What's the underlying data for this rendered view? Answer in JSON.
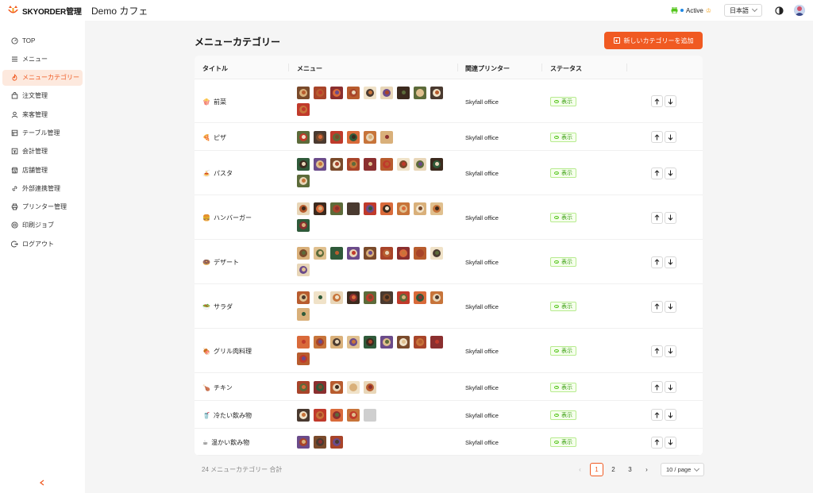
{
  "brand": {
    "name": "SKYORDER管理"
  },
  "header": {
    "store_name": "Demo カフェ",
    "printer_status": "Active",
    "language": "日本語"
  },
  "sidebar": {
    "items": [
      {
        "label": "TOP",
        "icon": "dashboard-icon",
        "active": false
      },
      {
        "label": "メニュー",
        "icon": "list-icon",
        "active": false
      },
      {
        "label": "メニューカテゴリー",
        "icon": "flame-icon",
        "active": true
      },
      {
        "label": "注文管理",
        "icon": "bag-icon",
        "active": false
      },
      {
        "label": "来客管理",
        "icon": "user-icon",
        "active": false
      },
      {
        "label": "テーブル管理",
        "icon": "table-icon",
        "active": false
      },
      {
        "label": "会計管理",
        "icon": "cash-icon",
        "active": false
      },
      {
        "label": "店舗管理",
        "icon": "store-icon",
        "active": false
      },
      {
        "label": "外部連携管理",
        "icon": "link-icon",
        "active": false
      },
      {
        "label": "プリンター管理",
        "icon": "printer-icon",
        "active": false
      },
      {
        "label": "印刷ジョブ",
        "icon": "print-job-icon",
        "active": false
      },
      {
        "label": "ログアウト",
        "icon": "logout-icon",
        "active": false
      }
    ]
  },
  "main": {
    "title": "メニューカテゴリー",
    "add_button": "新しいカテゴリーを追加",
    "columns": [
      "タイトル",
      "メニュー",
      "関連プリンター",
      "ステータス"
    ],
    "rows": [
      {
        "emoji": "🍿",
        "title": "前菜",
        "thumb_count": 10,
        "printer": "Skyfall office",
        "status": "表示"
      },
      {
        "emoji": "🍕",
        "title": "ピザ",
        "thumb_count": 6,
        "printer": "Skyfall office",
        "status": "表示"
      },
      {
        "emoji": "🍝",
        "title": "パスタ",
        "thumb_count": 10,
        "printer": "Skyfall office",
        "status": "表示"
      },
      {
        "emoji": "🍔",
        "title": "ハンバーガー",
        "thumb_count": 10,
        "printer": "Skyfall office",
        "status": "表示"
      },
      {
        "emoji": "🍩",
        "title": "デザート",
        "thumb_count": 10,
        "printer": "Skyfall office",
        "status": "表示"
      },
      {
        "emoji": "🥗",
        "title": "サラダ",
        "thumb_count": 10,
        "printer": "Skyfall office",
        "status": "表示"
      },
      {
        "emoji": "🍖",
        "title": "グリル肉料理",
        "thumb_count": 10,
        "printer": "Skyfall office",
        "status": "表示"
      },
      {
        "emoji": "🍗",
        "title": "チキン",
        "thumb_count": 5,
        "printer": "Skyfall office",
        "status": "表示"
      },
      {
        "emoji": "🥤",
        "title": "冷たい飲み物",
        "thumb_count": 5,
        "printer": "Skyfall office",
        "status": "表示"
      },
      {
        "emoji": "☕",
        "title": "温かい飲み物",
        "thumb_count": 3,
        "printer": "Skyfall office",
        "status": "表示"
      }
    ],
    "total": "24 メニューカテゴリー 合計",
    "pagination": {
      "pages": [
        "1",
        "2",
        "3"
      ],
      "current": "1",
      "page_size": "10 / page"
    }
  },
  "colors": {
    "accent": "#f05a22",
    "status_green": "#389e0d"
  }
}
